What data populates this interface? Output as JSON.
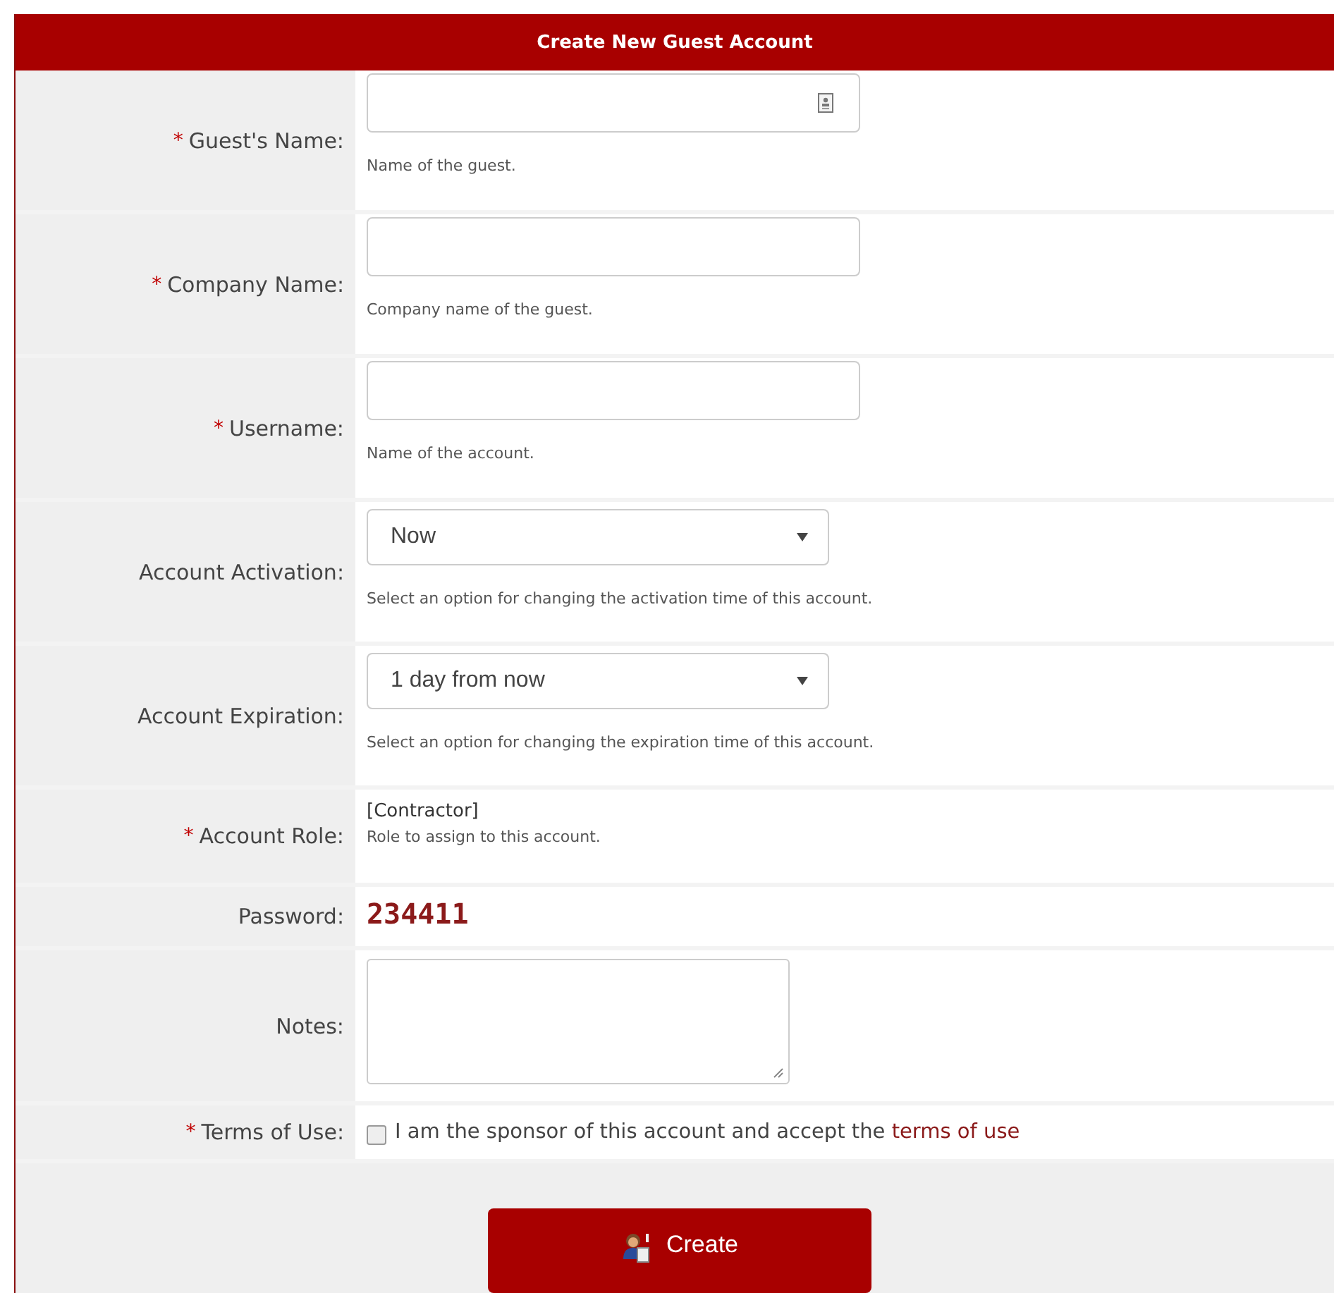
{
  "title": "Create New Guest Account",
  "rows": [
    {
      "kind": "text",
      "required": "*",
      "label": "Guest's Name:",
      "hint": "Name of the guest.",
      "contact_icon": true
    },
    {
      "kind": "text",
      "required": "*",
      "label": "Company Name:",
      "hint": "Company name of the guest."
    },
    {
      "kind": "text",
      "required": "*",
      "label": "Username:",
      "hint": "Name of the account."
    },
    {
      "kind": "select",
      "label": "Account Activation:",
      "value": "Now",
      "hint": "Select an option for changing the activation time of this account."
    },
    {
      "kind": "select",
      "label": "Account Expiration:",
      "value": "1 day from now",
      "hint": "Select an option for changing the expiration time of this account."
    },
    {
      "kind": "static",
      "required": "*",
      "label": "Account Role:",
      "value": "[Contractor]",
      "hint": "Role to assign to this account."
    },
    {
      "kind": "password",
      "label": "Password:",
      "value": "234411"
    },
    {
      "kind": "textarea",
      "label": "Notes:"
    },
    {
      "kind": "checkbox",
      "required": "*",
      "label": "Terms of Use:",
      "checked": false,
      "text": "I am the sponsor of this account and accept the",
      "link": "terms of use"
    }
  ],
  "button": {
    "label": "Create"
  }
}
